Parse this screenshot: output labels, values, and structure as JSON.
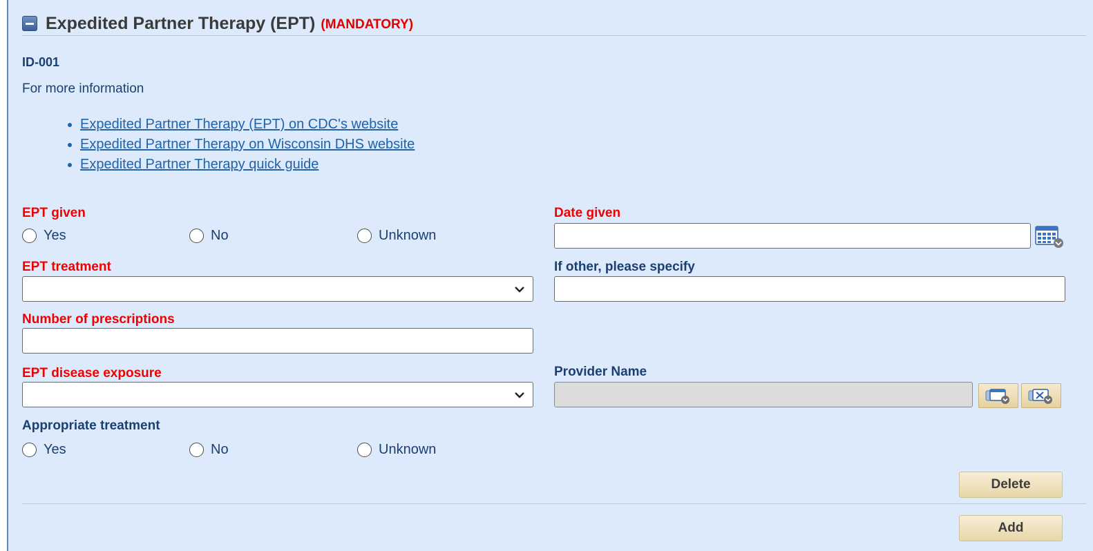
{
  "section": {
    "title": "Expedited Partner Therapy (EPT)",
    "mandatory_tag": "(MANDATORY)"
  },
  "id_label": "ID-001",
  "info_text": "For more information",
  "links": [
    "Expedited Partner Therapy (EPT) on CDC's website",
    "Expedited Partner Therapy on Wisconsin DHS website",
    "Expedited Partner Therapy quick guide"
  ],
  "ept_given": {
    "label": "EPT given",
    "options": [
      "Yes",
      "No",
      "Unknown"
    ]
  },
  "date_given": {
    "label": "Date given",
    "value": ""
  },
  "ept_treatment": {
    "label": "EPT treatment",
    "selected": ""
  },
  "if_other": {
    "label": "If other, please specify",
    "value": ""
  },
  "num_prescriptions": {
    "label": "Number of prescriptions",
    "value": ""
  },
  "disease_exposure": {
    "label": "EPT disease exposure",
    "selected": ""
  },
  "provider_name": {
    "label": "Provider Name",
    "value": ""
  },
  "appropriate_treatment": {
    "label": "Appropriate treatment",
    "options": [
      "Yes",
      "No",
      "Unknown"
    ]
  },
  "buttons": {
    "delete": "Delete",
    "add": "Add"
  },
  "icons": {
    "collapse": "minus-collapse-icon",
    "calendar": "calendar-icon",
    "provider_search": "card-search-icon",
    "provider_clear": "card-clear-icon",
    "dropdown": "chevron-down-icon"
  },
  "colors": {
    "panel_bg": "#dceafb",
    "required_label": "#f00000",
    "optional_label": "#1c3f72",
    "link": "#2163a8"
  }
}
